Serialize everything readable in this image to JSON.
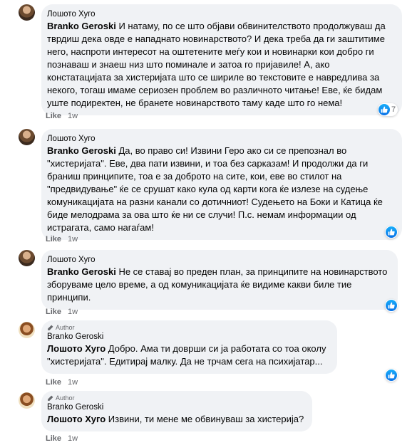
{
  "comments": [
    {
      "is_author": false,
      "author_tag": "",
      "name": "Лошото Хуго",
      "mention": "Branko Geroski",
      "text": " И натаму, по се што објави обвинителството продолжуваш да тврдиш дека овде е нападнато новинарството? И дека треба да ги заштитиме него, наспроти интересот на оштетените меѓу кои и новинарки кои добро ги познаваш и знаеш низ што поминале и затоа го пријавиле! А, ако констатацијата за хистеријата што се шириле во текстовите е навредлива за некого, тогаш имаме сериозен проблем во различното читање! Еве, ќе бидам уште подиректен, не бранете новинарството таму каде што го нема!",
      "like_label": "Like",
      "time": "1w",
      "reaction_count": "7"
    },
    {
      "is_author": false,
      "author_tag": "",
      "name": "Лошото Хуго",
      "mention": "Branko Geroski",
      "text": " Да, во право си! Извини Геро ако си се препознал во \"хистеријата\". Еве, два пати извини, и тоа без сарказам! И продолжи да ги браниш принципите, тоа е за доброто на сите, кои, еве во стилот на \"предвидување\" ќе се срушат како кула од карти кога ќе излезе на судење комуникацијата на разни канали со дотичниот! Судењето на Боки и Катица ќе биде мелодрама за ова што ќе ни се случи! П.с. немам информации од истрагата, само нагаѓам!",
      "like_label": "Like",
      "time": "1w",
      "reaction_count": ""
    },
    {
      "is_author": false,
      "author_tag": "",
      "name": "Лошото Хуго",
      "mention": "Branko Geroski",
      "text": " Не се ставај во преден план, за принципите на новинарството зборуваме цело време, а од комуникацијата ќе видиме какви биле тие принципи.",
      "like_label": "Like",
      "time": "1w",
      "reaction_count": ""
    },
    {
      "is_author": true,
      "author_tag": "Author",
      "name": "Branko Geroski",
      "mention": "Лошото Хуго",
      "text": " Добро. Ама ти доврши си ја работата со тоа околу \"хистеријата\". Едитирај малку. Да не трчам сега на психијатар...",
      "like_label": "Like",
      "time": "1w",
      "reaction_count": ""
    },
    {
      "is_author": true,
      "author_tag": "Author",
      "name": "Branko Geroski",
      "mention": "Лошото Хуго",
      "text": " Извини, ти мене ме обвинуваш за хистерија?",
      "like_label": "Like",
      "time": "1w",
      "reaction_count": ""
    }
  ],
  "colors": {
    "bubble": "#f0f2f5",
    "secondary_text": "#65676b",
    "like_blue": "#1877f2"
  },
  "icons": {
    "reaction": "like-thumb-icon",
    "author": "pen-icon"
  }
}
